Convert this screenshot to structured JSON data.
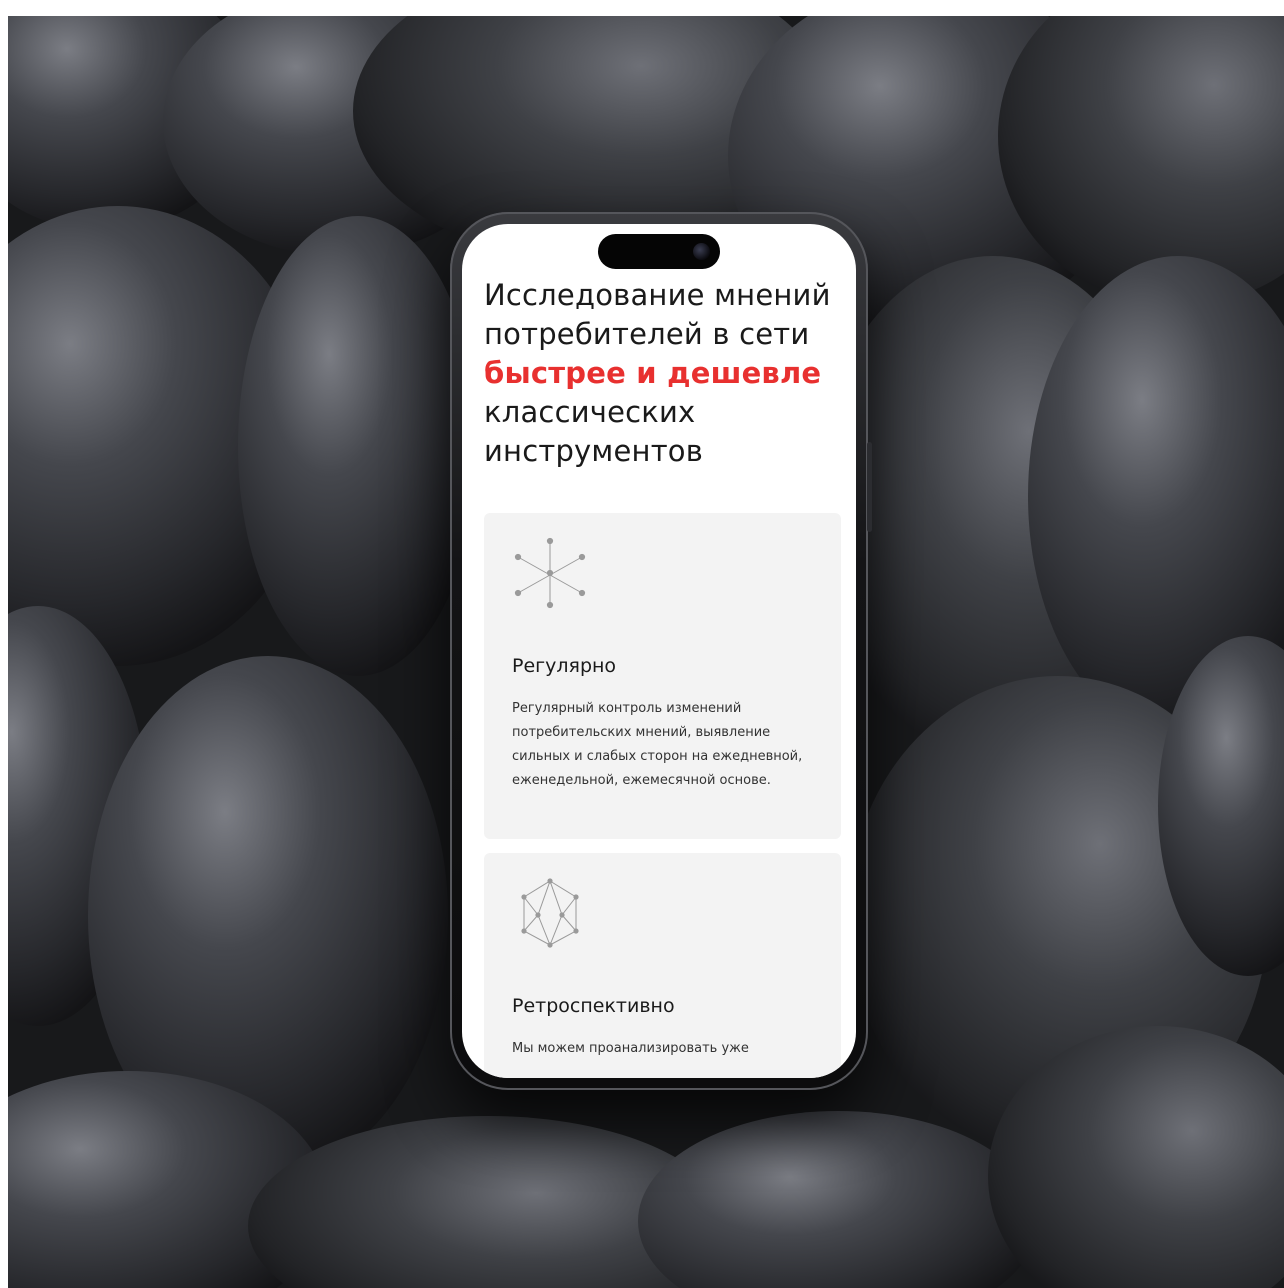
{
  "screen": {
    "headline": {
      "line1": "Исследование мнений",
      "line2": "потребителей в сети",
      "accent": "быстрее и дешевле",
      "line4": "классических",
      "line5": "инструментов"
    },
    "cards": [
      {
        "icon": "asterisk-network-icon",
        "title": "Регулярно",
        "text": "Регулярный контроль изменений потребительских мнений, выявление сильных и слабых сторон на ежедневной, еженедельной, ежемесячной основе."
      },
      {
        "icon": "hexagon-network-icon",
        "title": "Ретроспективно",
        "text": "Мы можем проанализировать уже"
      }
    ]
  },
  "colors": {
    "accent": "#e8302f",
    "card_background": "#f3f3f3",
    "text": "#1a1a1a",
    "backdrop": "#1e1f22"
  }
}
